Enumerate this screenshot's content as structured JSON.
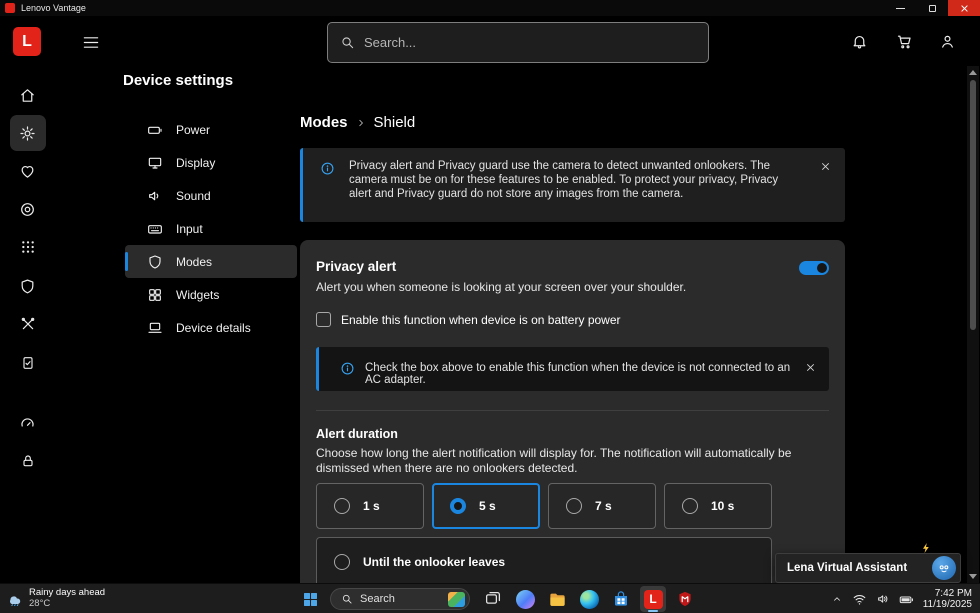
{
  "titlebar": {
    "title": "Lenovo Vantage"
  },
  "logo": {
    "letter": "L"
  },
  "appbar": {
    "search_placeholder": "Search..."
  },
  "sidenav": {
    "heading": "Device settings",
    "items": [
      {
        "label": "Power",
        "active": false
      },
      {
        "label": "Display",
        "active": false
      },
      {
        "label": "Sound",
        "active": false
      },
      {
        "label": "Input",
        "active": false
      },
      {
        "label": "Modes",
        "active": true
      },
      {
        "label": "Widgets",
        "active": false
      },
      {
        "label": "Device details",
        "active": false
      }
    ]
  },
  "main": {
    "breadcrumb": {
      "parent": "Modes",
      "current": "Shield"
    },
    "info_banner": "Privacy alert and Privacy guard use the camera to detect unwanted onlookers. The camera must be on for these features to be enabled. To protect your privacy, Privacy alert and Privacy guard do not store any images from the camera.",
    "privacy_alert": {
      "title": "Privacy alert",
      "toggle_on": true,
      "description": "Alert you when someone is looking at your screen over your shoulder.",
      "battery_checkbox": {
        "label": "Enable this function when device is on battery power",
        "checked": false
      },
      "note": "Check the box above to enable this function when the device is not connected to an AC adapter.",
      "alert_duration": {
        "title": "Alert duration",
        "description": "Choose how long the alert notification will display for. The notification will automatically be dismissed when there are no onlookers detected.",
        "options": [
          {
            "label": "1 s",
            "selected": false
          },
          {
            "label": "5 s",
            "selected": true
          },
          {
            "label": "7 s",
            "selected": false
          },
          {
            "label": "10 s",
            "selected": false
          },
          {
            "label": "Until the onlooker leaves",
            "selected": false
          }
        ]
      }
    }
  },
  "assistant": {
    "label": "Lena Virtual Assistant"
  },
  "taskbar": {
    "weather": {
      "line1": "Rainy days ahead",
      "line2": "28°C"
    },
    "search_label": "Search",
    "clock": {
      "time": "7:42 PM",
      "date": "11/19/2025"
    }
  },
  "colors": {
    "accent": "#1a86e0",
    "lenovo_red": "#E2231A"
  },
  "icons": {
    "rail": [
      "home-icon",
      "gear-icon",
      "heart-icon",
      "lifebuoy-icon",
      "apps-grid-icon",
      "shield-icon",
      "tools-icon",
      "clipboard-check-icon",
      "gauge-icon",
      "lock-icon"
    ],
    "appbar": [
      "menu-icon",
      "search-icon",
      "bell-icon",
      "cart-icon",
      "user-icon"
    ],
    "nav": [
      "battery-icon",
      "monitor-icon",
      "speaker-icon",
      "keyboard-icon",
      "shield-icon",
      "widgets-icon",
      "laptop-icon"
    ],
    "banners": [
      "info-icon",
      "close-icon"
    ],
    "taskbar": [
      "weather-icon",
      "start-icon",
      "search-icon",
      "task-view-icon",
      "copilot-icon",
      "file-explorer-icon",
      "edge-icon",
      "store-icon",
      "vantage-icon",
      "mcafee-icon",
      "tray-chevron-icon",
      "wifi-icon",
      "volume-icon",
      "battery-icon"
    ]
  }
}
